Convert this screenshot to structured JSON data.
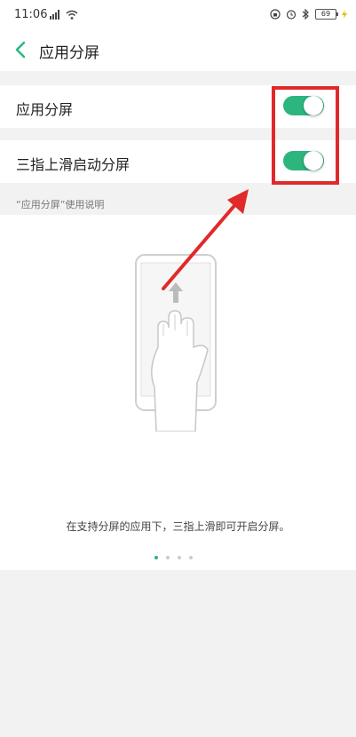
{
  "statusbar": {
    "time": "11:06",
    "battery": "69"
  },
  "header": {
    "title": "应用分屏"
  },
  "settings": [
    {
      "label": "应用分屏",
      "on": true
    },
    {
      "label": "三指上滑启动分屏",
      "on": true
    }
  ],
  "section_note": "“应用分屏”使用说明",
  "guide": {
    "caption": "在支持分屏的应用下，三指上滑即可开启分屏。",
    "page_count": 4,
    "active_page": 1
  },
  "colors": {
    "accent": "#2cb67d",
    "annotation": "#e02a2a",
    "background": "#f2f2f2"
  }
}
